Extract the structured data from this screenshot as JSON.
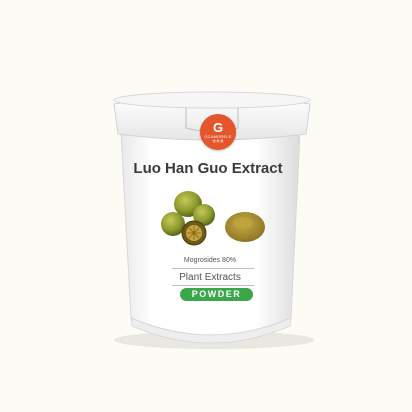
{
  "product": {
    "title": "Luo Han Guo Extract",
    "spec": "Mogrosides 80%",
    "category": "Plant Extracts",
    "form": "POWDER"
  },
  "logo": {
    "glyph": "G",
    "brand": "GCAMORELE",
    "cn": "怡 樂 黑",
    "icon": "logo-mark"
  },
  "colors": {
    "background": "#fdfbf6",
    "logo": "#e4552b",
    "pill": "#3aa84a",
    "fruit": "#8a9a2a",
    "powder": "#a8902f"
  }
}
